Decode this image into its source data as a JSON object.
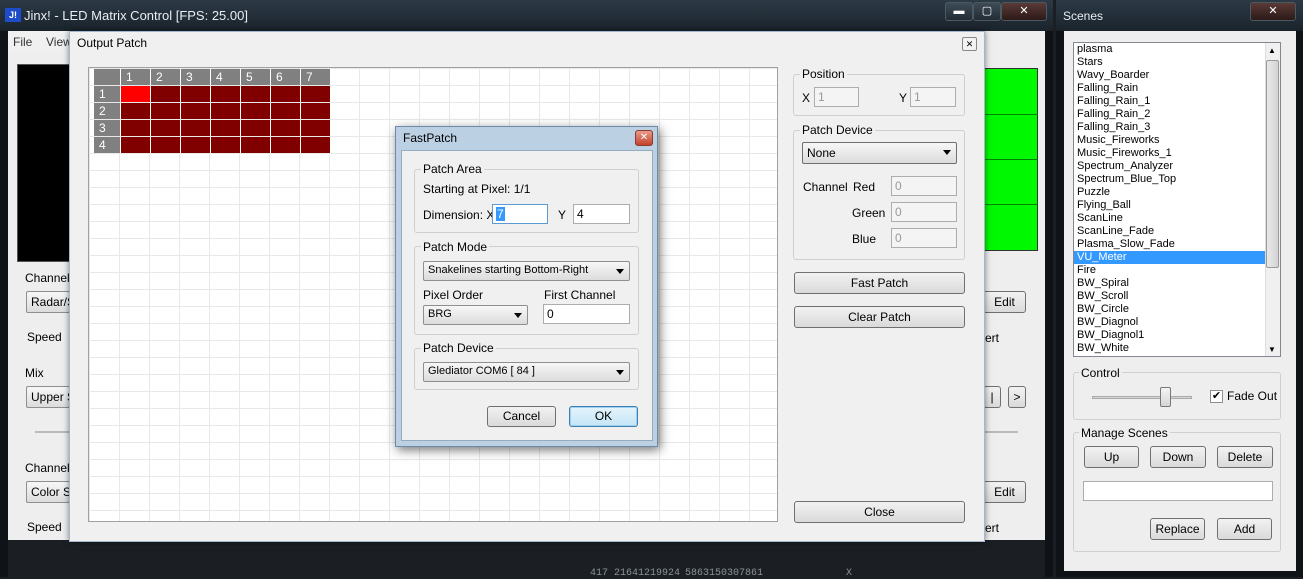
{
  "main_window": {
    "title": "Jinx! - LED Matrix Control [FPS: 25.00]",
    "icon_text": "J!",
    "menu": [
      "File",
      "View"
    ],
    "min_glyph": "▬",
    "max_glyph": "▢",
    "close_glyph": "✕",
    "left_panel": {
      "channel1_label": "Channel",
      "channel1_combo": "Radar/S",
      "speed1_label": "Speed",
      "mix_label": "Mix",
      "mix_combo": "Upper S",
      "channel2_label": "Channel",
      "channel2_combo": "Color Sc",
      "speed2_label": "Speed"
    },
    "right_panel": {
      "edit1": "Edit",
      "vert1": "ert",
      "nav_left": "|",
      "nav_right": ">",
      "edit2": "Edit",
      "vert2": "ert"
    },
    "bottom_values": [
      "417 21641219924",
      "5863150307861",
      "X"
    ]
  },
  "scenes_window": {
    "title": "Scenes",
    "close_glyph": "✕",
    "items": [
      "plasma",
      "Stars",
      "Wavy_Boarder",
      "Falling_Rain",
      "Falling_Rain_1",
      "Falling_Rain_2",
      "Falling_Rain_3",
      "Music_Fireworks",
      "Music_Fireworks_1",
      "Spectrum_Analyzer",
      "Spectrum_Blue_Top",
      "Puzzle",
      "Flying_Ball",
      "ScanLine",
      "ScanLine_Fade",
      "Plasma_Slow_Fade",
      "VU_Meter",
      "Fire",
      "BW_Spiral",
      "BW_Scroll",
      "BW_Circle",
      "BW_Diagnol",
      "BW_Diagnol1",
      "BW_White"
    ],
    "selected_index": 16,
    "control_label": "Control",
    "fade_out_label": "Fade Out",
    "fade_out_checked": true,
    "manage_label": "Manage Scenes",
    "buttons": {
      "up": "Up",
      "down": "Down",
      "delete": "Delete",
      "replace": "Replace",
      "add": "Add"
    },
    "name_value": ""
  },
  "output_patch": {
    "title": "Output Patch",
    "close_glyph": "✕",
    "column_headers": [
      "1",
      "2",
      "3",
      "4",
      "5",
      "6",
      "7"
    ],
    "row_headers": [
      "1",
      "2",
      "3",
      "4"
    ],
    "highlight_cell": [
      1,
      1
    ],
    "colors": {
      "patched": "#800000",
      "selected": "#ff0000",
      "header": "#808080"
    },
    "position": {
      "label": "Position",
      "x_label": "X",
      "x_value": "1",
      "y_label": "Y",
      "y_value": "1"
    },
    "patch_device": {
      "label": "Patch Device",
      "value": "None",
      "channel_label": "Channel",
      "red_label": "Red",
      "red_value": "0",
      "green_label": "Green",
      "green_value": "0",
      "blue_label": "Blue",
      "blue_value": "0"
    },
    "fast_patch_button": "Fast Patch",
    "clear_patch_button": "Clear Patch",
    "close_button": "Close"
  },
  "fastpatch": {
    "title": "FastPatch",
    "close_glyph": "✕",
    "patch_area_label": "Patch Area",
    "starting_text": "Starting at Pixel: 1/1",
    "dimension_label": "Dimension: X",
    "dim_x": "7",
    "y_label": "Y",
    "dim_y": "4",
    "patch_mode_label": "Patch Mode",
    "patch_mode_value": "Snakelines starting Bottom-Right",
    "pixel_order_label": "Pixel Order",
    "pixel_order_value": "BRG",
    "first_channel_label": "First Channel",
    "first_channel_value": "0",
    "patch_device_label": "Patch Device",
    "patch_device_value": "Glediator COM6 [ 84 ]",
    "cancel": "Cancel",
    "ok": "OK"
  }
}
